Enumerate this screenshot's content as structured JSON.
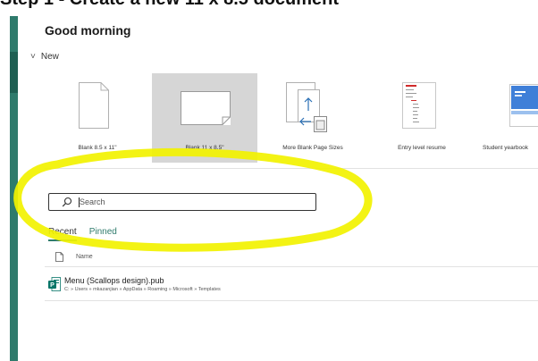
{
  "caption": "Step 1 - Create a new 11 x 8.5 document",
  "greeting": "Good morning",
  "new_section": {
    "label": "New",
    "chevron": "chevron-down-icon"
  },
  "templates": [
    {
      "label": "Blank 8.5 x 11\""
    },
    {
      "label": "Blank 11 x 8.5\"",
      "selected": true
    },
    {
      "label": "More Blank Page Sizes"
    },
    {
      "label": "Entry level resume"
    },
    {
      "label": "Student yearbook"
    }
  ],
  "search": {
    "placeholder": "Search",
    "icon": "search-icon"
  },
  "tabs": {
    "recent": "Recent",
    "pinned": "Pinned"
  },
  "list": {
    "header": "Name",
    "files": [
      {
        "name": "Menu (Scallops design).pub",
        "path": "C: » Users » mkazanjian » AppData » Roaming » Microsoft » Templates",
        "icon": "publisher-file-icon"
      }
    ]
  },
  "colors": {
    "accent": "#2f7b6c",
    "highlight": "#f2f200",
    "publisher": "#077568"
  }
}
